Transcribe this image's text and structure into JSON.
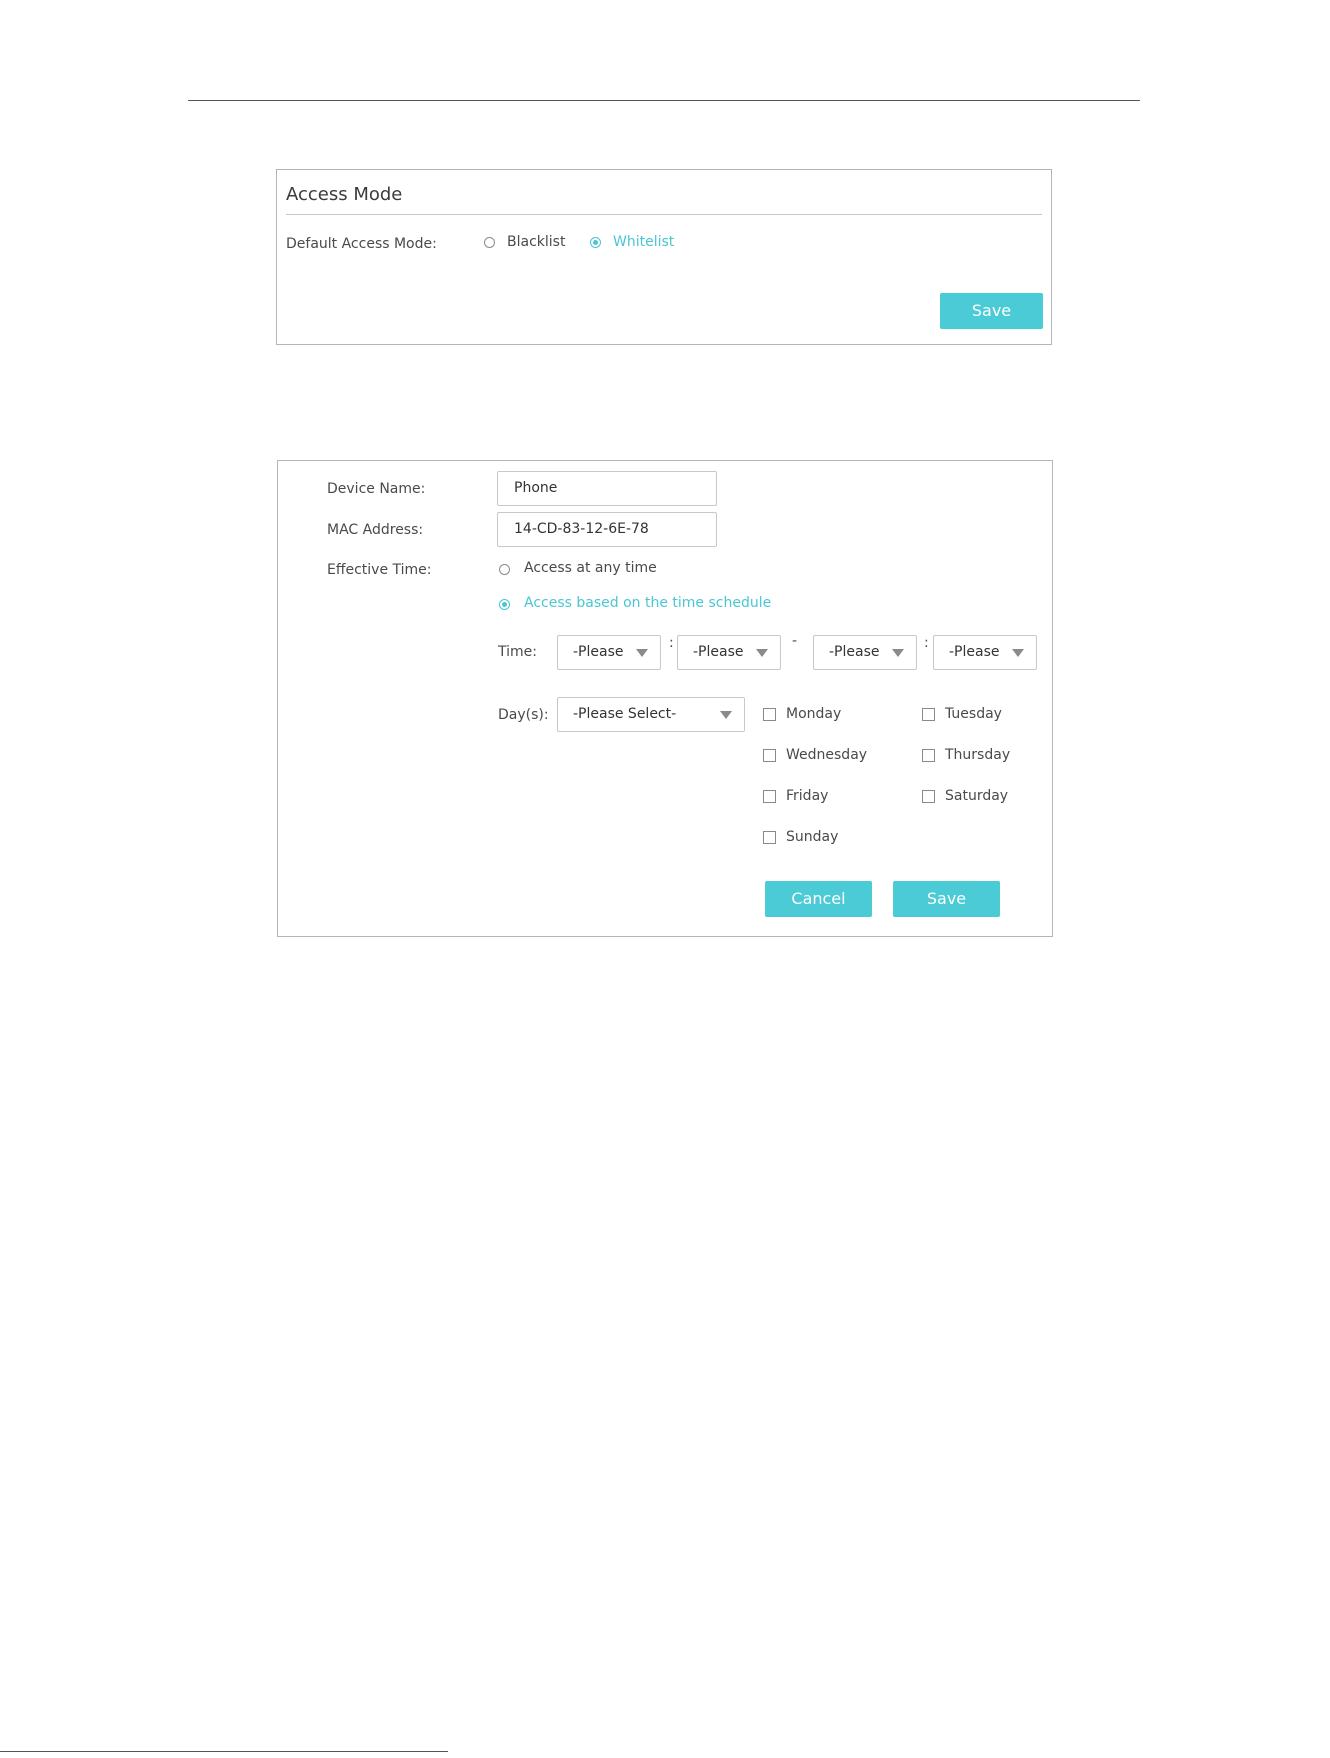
{
  "access_mode": {
    "title": "Access Mode",
    "default_label": "Default Access Mode:",
    "options": [
      {
        "label": "Blacklist",
        "selected": false
      },
      {
        "label": "Whitelist",
        "selected": true
      }
    ],
    "save_label": "Save"
  },
  "device_form": {
    "device_name_label": "Device Name:",
    "device_name_value": "Phone",
    "mac_label": "MAC Address:",
    "mac_value": "14-CD-83-12-6E-78",
    "effective_time_label": "Effective Time:",
    "time_options": [
      {
        "label": "Access at any time",
        "selected": false
      },
      {
        "label": "Access based on the time schedule",
        "selected": true
      }
    ],
    "time_label": "Time:",
    "time_selects": [
      "-Please",
      "-Please",
      "-Please",
      "-Please"
    ],
    "colon": ":",
    "dash": "-",
    "days_label": "Day(s):",
    "days_select": "-Please Select-",
    "days": [
      {
        "label": "Monday",
        "checked": false
      },
      {
        "label": "Tuesday",
        "checked": false
      },
      {
        "label": "Wednesday",
        "checked": false
      },
      {
        "label": "Thursday",
        "checked": false
      },
      {
        "label": "Friday",
        "checked": false
      },
      {
        "label": "Saturday",
        "checked": false
      },
      {
        "label": "Sunday",
        "checked": false
      }
    ],
    "cancel_label": "Cancel",
    "save_label": "Save"
  },
  "colors": {
    "accent": "#4acbd6",
    "border": "#b5b5b5"
  }
}
